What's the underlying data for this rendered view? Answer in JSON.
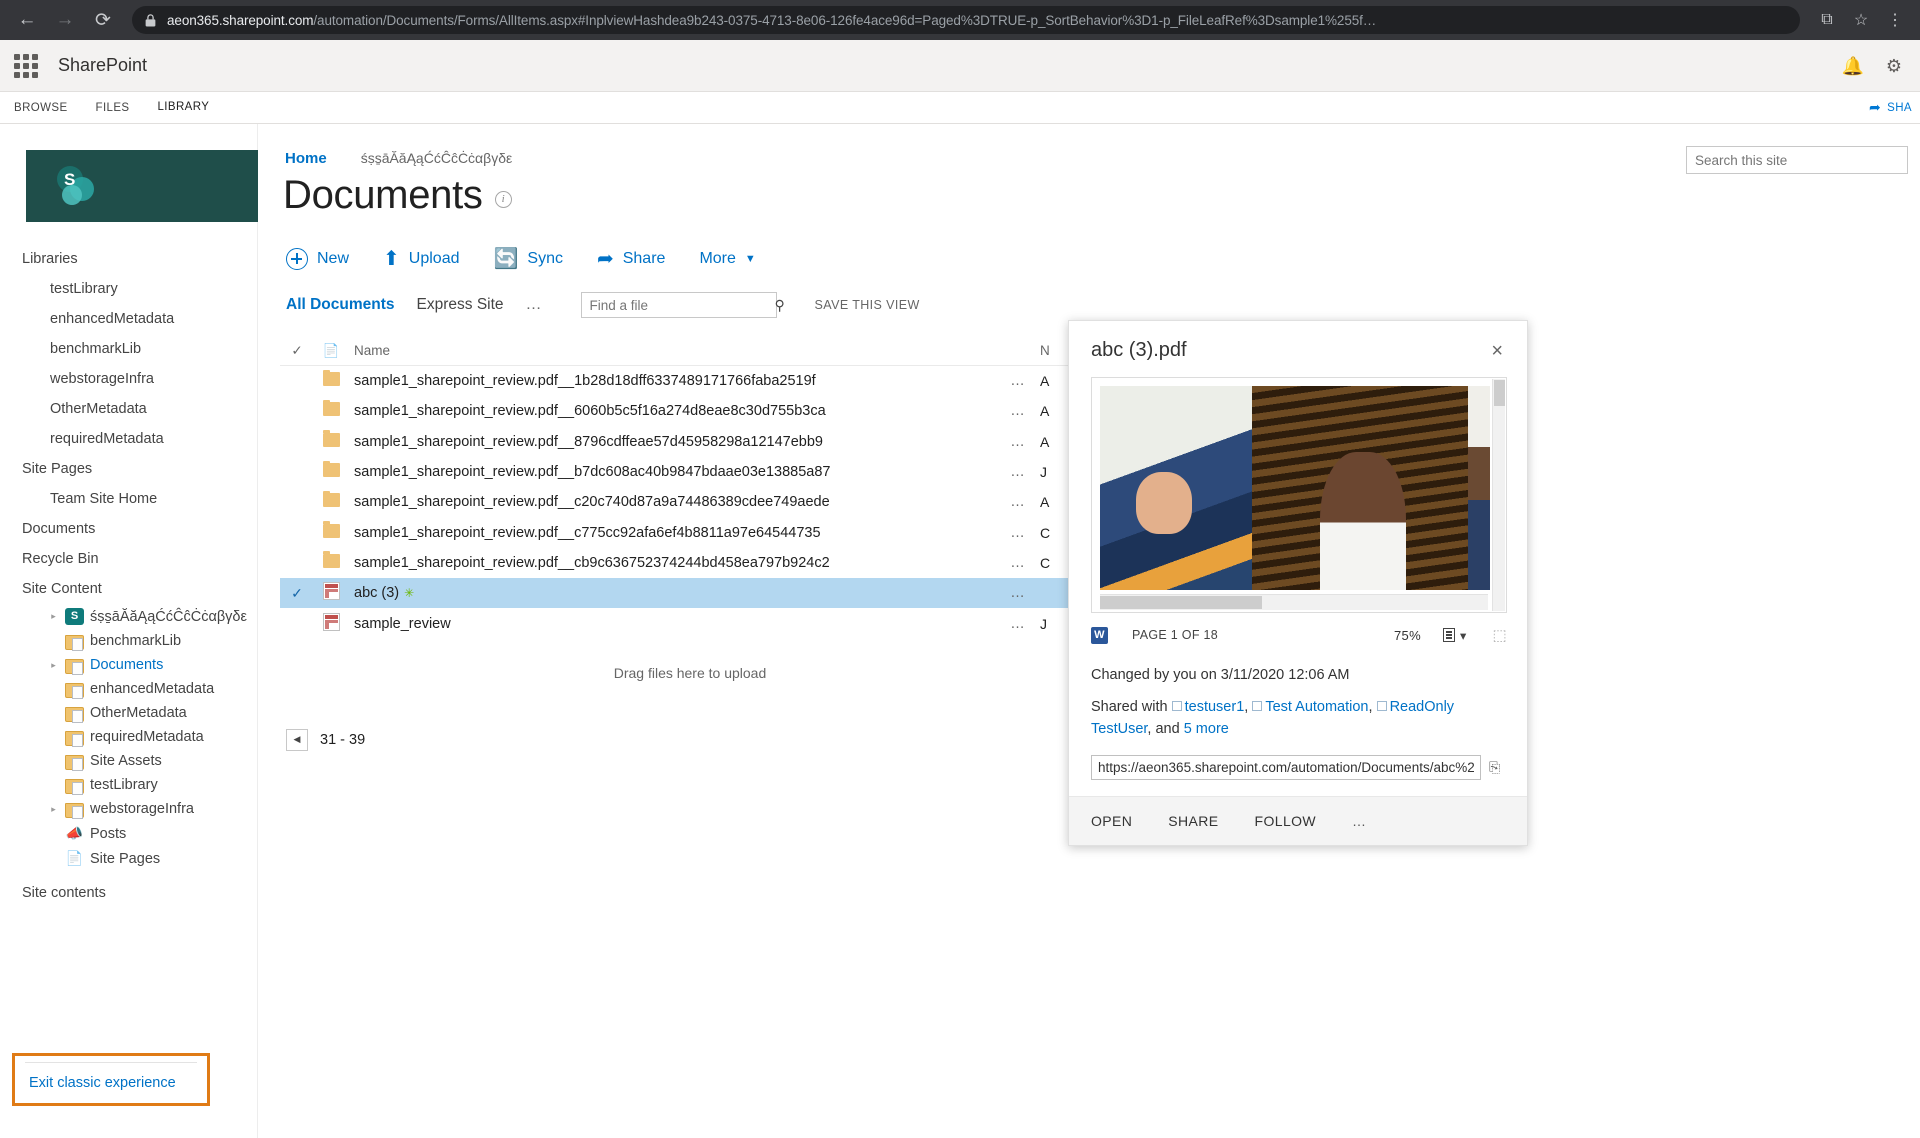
{
  "browser": {
    "back_icon": "←",
    "forward_icon": "→",
    "reload_icon": "⟳",
    "url_host": "aeon365.sharepoint.com",
    "url_path": "/automation/Documents/Forms/AllItems.aspx#InplviewHashdea9b243-0375-4713-8e06-126fe4ace96d=Paged%3DTRUE-p_SortBehavior%3D1-p_FileLeafRef%3Dsample1%255f…",
    "extensions_icon": "⧉",
    "bookmark_icon": "☆",
    "menu_icon": "⋮"
  },
  "suite": {
    "app_launcher": "waffle-icon",
    "title": "SharePoint",
    "notification_icon": "🔔",
    "settings_icon": "⚙"
  },
  "ribbon": {
    "tabs": [
      {
        "label": "BROWSE",
        "active": false
      },
      {
        "label": "FILES",
        "active": false
      },
      {
        "label": "LIBRARY",
        "active": false
      }
    ],
    "share_label": "SHA",
    "share_icon": "share-icon"
  },
  "leftnav": {
    "groups": [
      {
        "label": "Libraries",
        "type": "head"
      },
      {
        "label": "testLibrary",
        "type": "sub"
      },
      {
        "label": "enhancedMetadata",
        "type": "sub"
      },
      {
        "label": "benchmarkLib",
        "type": "sub"
      },
      {
        "label": "webstorageInfra",
        "type": "sub"
      },
      {
        "label": "OtherMetadata",
        "type": "sub"
      },
      {
        "label": "requiredMetadata",
        "type": "sub"
      },
      {
        "label": "Site Pages",
        "type": "head"
      },
      {
        "label": "Team Site Home",
        "type": "sub"
      },
      {
        "label": "Documents",
        "type": "head"
      },
      {
        "label": "Recycle Bin",
        "type": "head"
      },
      {
        "label": "Site Content",
        "type": "head"
      }
    ],
    "tree": [
      {
        "label": "śṣs̱āĂăĄąĆćĈĉĊċαβγδε",
        "icon": "sharepoint-site-icon",
        "twisty": true,
        "link": false
      },
      {
        "label": "benchmarkLib",
        "icon": "folder-icon",
        "twisty": false,
        "link": false
      },
      {
        "label": "Documents",
        "icon": "folder-icon",
        "twisty": true,
        "link": true
      },
      {
        "label": "enhancedMetadata",
        "icon": "folder-icon",
        "twisty": false,
        "link": false
      },
      {
        "label": "OtherMetadata",
        "icon": "folder-icon",
        "twisty": false,
        "link": false
      },
      {
        "label": "requiredMetadata",
        "icon": "folder-icon",
        "twisty": false,
        "link": false
      },
      {
        "label": "Site Assets",
        "icon": "folder-icon",
        "twisty": false,
        "link": false
      },
      {
        "label": "testLibrary",
        "icon": "folder-icon",
        "twisty": false,
        "link": false
      },
      {
        "label": "webstorageInfra",
        "icon": "folder-icon",
        "twisty": true,
        "link": false
      },
      {
        "label": "Posts",
        "icon": "megaphone-icon",
        "twisty": false,
        "link": false
      },
      {
        "label": "Site Pages",
        "icon": "page-icon",
        "twisty": false,
        "link": false
      }
    ],
    "site_contents": "Site contents",
    "exit_classic": "Exit classic experience",
    "highlight_color": "#e07b16"
  },
  "header": {
    "breadcrumb_home": "Home",
    "breadcrumb_site": "śṣs̱āĂăĄąĆćĈĉĊċαβγδε",
    "title": "Documents",
    "info_icon": "i"
  },
  "commands": [
    {
      "label": "New",
      "icon": "plus-circle-icon"
    },
    {
      "label": "Upload",
      "icon": "upload-icon"
    },
    {
      "label": "Sync",
      "icon": "sync-icon"
    },
    {
      "label": "Share",
      "icon": "share-icon"
    },
    {
      "label": "More",
      "icon": "chevron-down-icon"
    }
  ],
  "viewbar": {
    "tabs": [
      {
        "label": "All Documents",
        "active": true
      },
      {
        "label": "Express Site",
        "active": false
      }
    ],
    "ellipsis": "…",
    "find_placeholder": "Find a file",
    "find_value": "",
    "search_icon": "🔍",
    "save_this_view": "SAVE THIS VIEW"
  },
  "site_search": {
    "placeholder": "Search this site",
    "value": ""
  },
  "table": {
    "headers": {
      "check": "✓",
      "type": "doc-icon",
      "name": "Name",
      "modified": "N"
    },
    "rows": [
      {
        "name": "sample1_sharepoint_review.pdf__1b28d18dff6337489171766faba2519f",
        "icon": "folder-icon",
        "modified": "A",
        "selected": false,
        "new": false
      },
      {
        "name": "sample1_sharepoint_review.pdf__6060b5c5f16a274d8eae8c30d755b3ca",
        "icon": "folder-icon",
        "modified": "A",
        "selected": false,
        "new": false
      },
      {
        "name": "sample1_sharepoint_review.pdf__8796cdffeae57d45958298a12147ebb9",
        "icon": "folder-icon",
        "modified": "A",
        "selected": false,
        "new": false
      },
      {
        "name": "sample1_sharepoint_review.pdf__b7dc608ac40b9847bdaae03e13885a87",
        "icon": "folder-icon",
        "modified": "J",
        "selected": false,
        "new": false
      },
      {
        "name": "sample1_sharepoint_review.pdf__c20c740d87a9a74486389cdee749aede",
        "icon": "folder-icon",
        "modified": "A",
        "selected": false,
        "new": false
      },
      {
        "name": "sample1_sharepoint_review.pdf__c775cc92afa6ef4b8811a97e64544735",
        "icon": "folder-icon",
        "modified": "C",
        "selected": false,
        "new": false
      },
      {
        "name": "sample1_sharepoint_review.pdf__cb9c636752374244bd458ea797b924c2",
        "icon": "folder-icon",
        "modified": "C",
        "selected": false,
        "new": false
      },
      {
        "name": "abc (3)",
        "icon": "excel-icon",
        "modified": "",
        "selected": true,
        "new": true
      },
      {
        "name": "sample_review",
        "icon": "excel-icon",
        "modified": "J",
        "selected": false,
        "new": false
      }
    ],
    "new_badge": "✳",
    "row_ellipsis": "…",
    "drag_hint": "Drag files here to upload",
    "pager_prev_icon": "◀",
    "pager_label": "31 - 39"
  },
  "callout": {
    "title": "abc (3).pdf",
    "close_icon": "×",
    "page_indicator": "PAGE 1 OF 18",
    "zoom_level": "75%",
    "layout_icon": "page-layout-icon",
    "layout_caret": "▾",
    "expand_icon": "⬚",
    "file_type_icon": "word-icon",
    "changed_text": "Changed by you on 3/11/2020 12:06 AM",
    "shared_prefix": "Shared with",
    "shared_users": [
      "testuser1",
      "Test Automation",
      "ReadOnly TestUser"
    ],
    "shared_and": "and",
    "shared_more": "5 more",
    "url_value": "https://aeon365.sharepoint.com/automation/Documents/abc%2",
    "copy_icon": "⎘",
    "actions": [
      {
        "label": "OPEN"
      },
      {
        "label": "SHARE"
      },
      {
        "label": "FOLLOW"
      }
    ],
    "actions_ellipsis": "…"
  }
}
